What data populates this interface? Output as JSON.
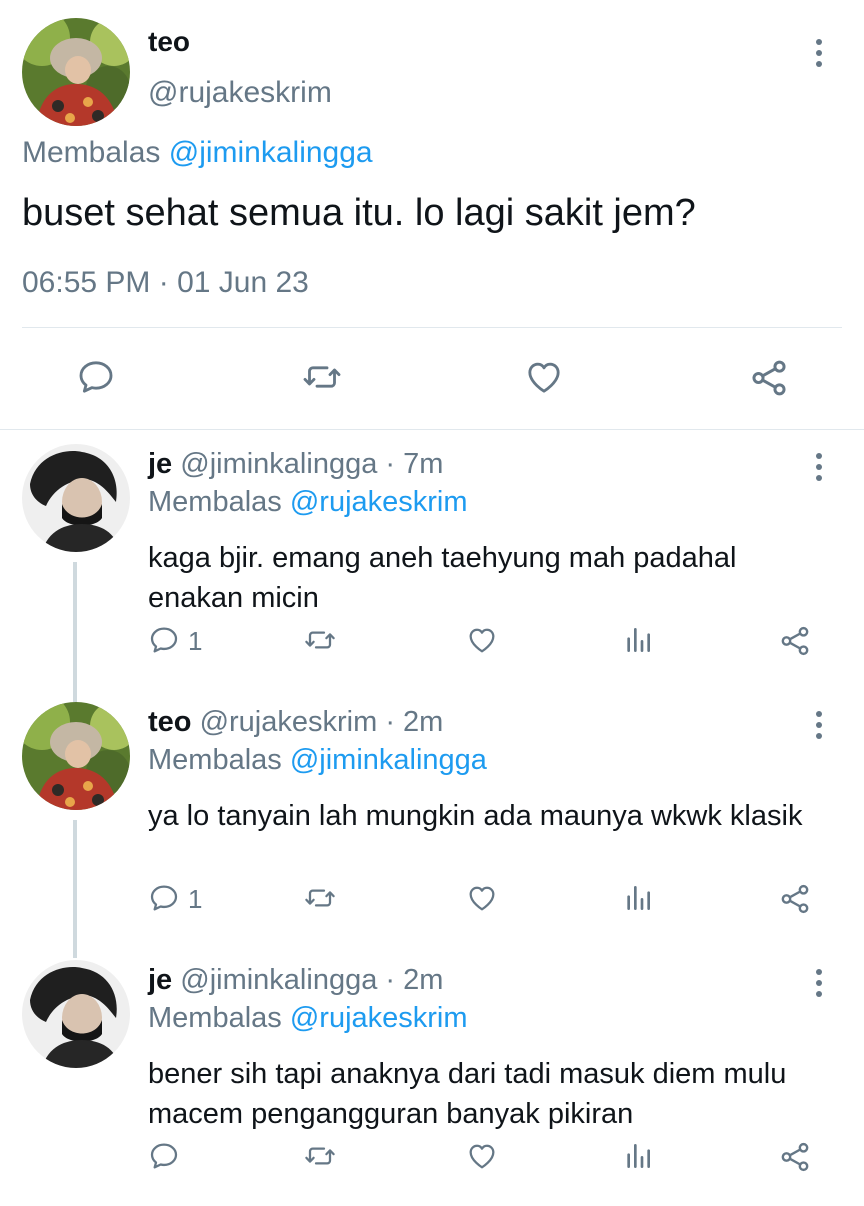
{
  "main_tweet": {
    "name": "teo",
    "handle": "@rujakeskrim",
    "reply_prefix": "Membalas",
    "reply_to": "@jiminkalingga",
    "text": "buset sehat semua itu. lo lagi sakit jem?",
    "timestamp": "06:55 PM · 01 Jun 23",
    "icons": [
      "reply-icon",
      "retweet-icon",
      "like-icon",
      "share-icon",
      "more-icon"
    ]
  },
  "replies": [
    {
      "name": "je",
      "handle": "@jiminkalingga",
      "time": "· 7m",
      "reply_prefix": "Membalas",
      "reply_to": "@rujakeskrim",
      "text": "kaga bjir. emang aneh taehyung mah padahal enakan micin",
      "reply_count": "1"
    },
    {
      "name": "teo",
      "handle": "@rujakeskrim",
      "time": "· 2m",
      "reply_prefix": "Membalas",
      "reply_to": "@jiminkalingga",
      "text": "ya lo tanyain lah mungkin ada maunya wkwk klasik",
      "reply_count": "1"
    },
    {
      "name": "je",
      "handle": "@jiminkalingga",
      "time": "· 2m",
      "reply_prefix": "Membalas",
      "reply_to": "@rujakeskrim",
      "text": "bener sih tapi anaknya dari tadi masuk diem mulu macem pengangguran banyak pikiran",
      "reply_count": ""
    }
  ],
  "colors": {
    "link": "#1d9bf0",
    "muted": "#657786",
    "divider": "#e1e8ed",
    "thread_line": "#cfd9de"
  }
}
